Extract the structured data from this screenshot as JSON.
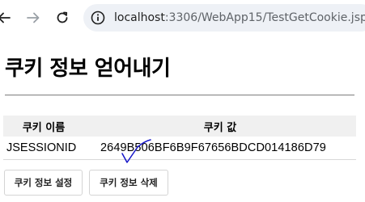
{
  "browser": {
    "url_host": "localhost",
    "url_path": ":3306/WebApp15/TestGetCookie.jsp"
  },
  "page": {
    "title": "쿠키 정보 얻어내기"
  },
  "table": {
    "headers": [
      "쿠키 이름",
      "쿠키 값"
    ],
    "rows": [
      {
        "name": "JSESSIONID",
        "value": "2649B506BF6B9F67656BDCD014186D79"
      }
    ]
  },
  "buttons": {
    "set_label": "쿠키 정보 설정",
    "delete_label": "쿠키 정보 삭제"
  },
  "colors": {
    "annotation_mark": "#1414c8",
    "omnibox_bg": "#eef1f6"
  }
}
